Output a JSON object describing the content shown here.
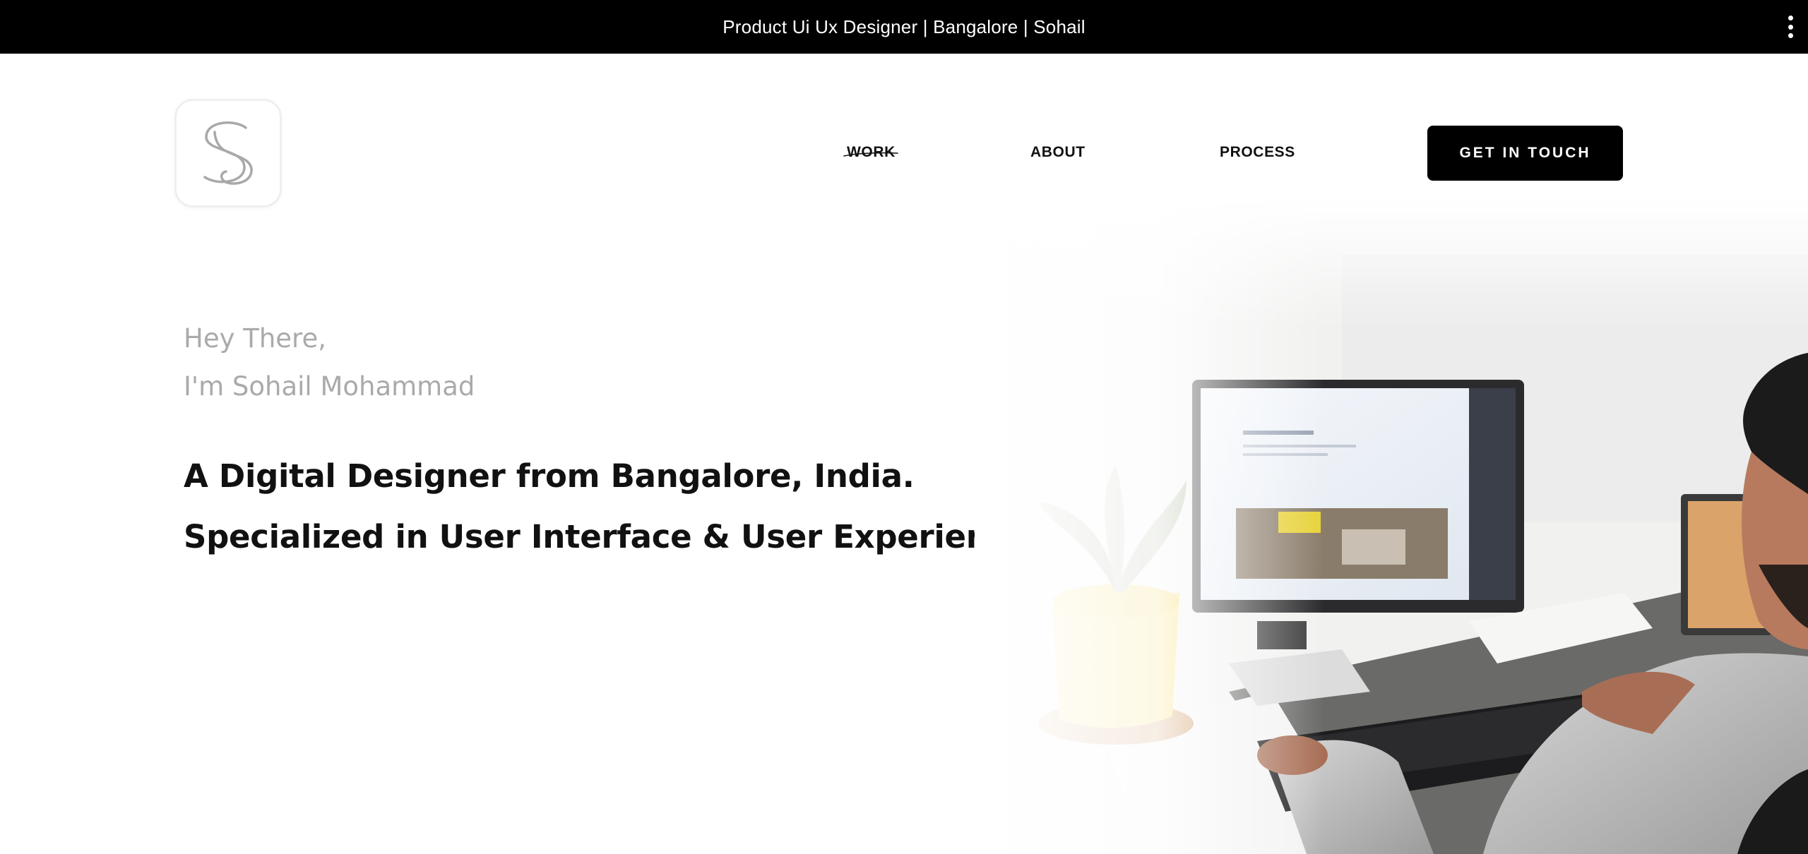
{
  "window": {
    "title": "Product Ui Ux Designer | Bangalore | Sohail",
    "menu_icon": "kebab-menu-icon"
  },
  "header": {
    "logo_icon": "s-monogram-logo-icon",
    "nav": {
      "work": "WORK",
      "about": "ABOUT",
      "process": "PROCESS"
    },
    "cta_label": "GET IN TOUCH"
  },
  "hero": {
    "greeting_line1": "Hey There,",
    "greeting_line2": "I'm Sohail Mohammad",
    "headline_line1": "A Digital Designer from Bangalore, India.",
    "headline_line2": "Specialized in User Interface & User Experience Design"
  },
  "colors": {
    "topbar_bg": "#000000",
    "cta_bg": "#000000",
    "greeting_text": "#aaaaaa",
    "headline_text": "#111111",
    "plant_pot": "#f8d857"
  }
}
